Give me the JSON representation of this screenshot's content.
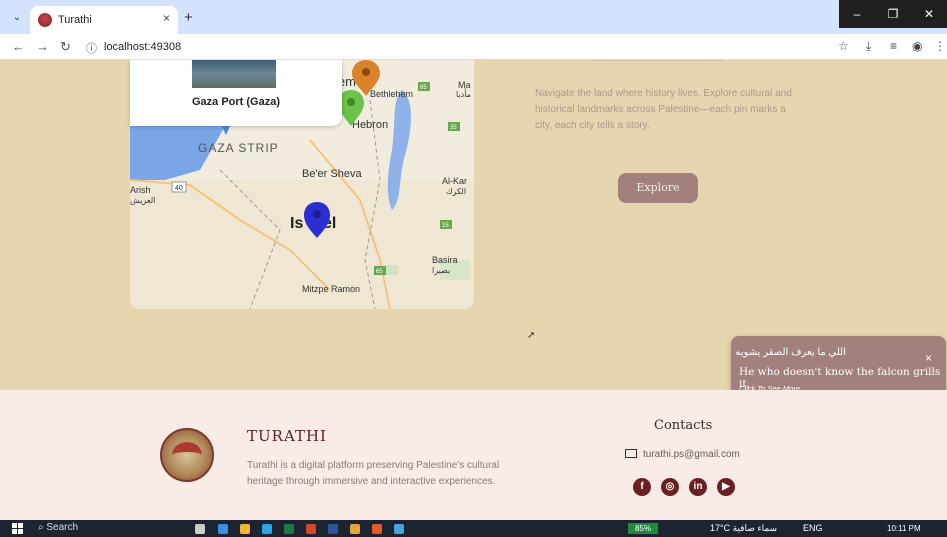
{
  "browser": {
    "tab_title": "Turathi",
    "tab_close": "×",
    "new_tab": "+",
    "url": "localhost:49308",
    "win_minimize": "–",
    "win_maximize": "❐",
    "win_close": "✕"
  },
  "map": {
    "popup_title": "Gaza Port (Gaza)",
    "labels": {
      "jerusalem_partial": "lem",
      "bethlehem": "Bethlehem",
      "hebron": "Hebron",
      "gaza_strip": "GAZA STRIP",
      "beer_sheva": "Be'er Sheva",
      "arish": "Arish",
      "arish_ar": "العريش",
      "road_40": "40",
      "israel_partial_left": "Is",
      "israel_partial_right": "el",
      "basira": "Basira",
      "basira_ar": "بصيرا",
      "mitzpe": "Mitzpe Ramon",
      "al_kark": "Al-Kar",
      "al_kark_ar": "الكرك",
      "ma": "Ma",
      "ma_ar": "مأدبا",
      "road_65_a": "65",
      "road_35": "35",
      "road_65_b": "65",
      "road_15": "15"
    },
    "marker_colors": {
      "orange": "#d9822b",
      "green": "#6cc24a",
      "blue": "#2a2fd1"
    }
  },
  "section": {
    "description": "Navigate the land where history lives. Explore cultural and historical landmarks across Palestine—each pin marks a city, each city tells a story.",
    "explore_label": "Explore"
  },
  "toast": {
    "arabic": "اللي ما يعرف الصقر يشويه",
    "english": "He who doesn't know the falcon grills it.",
    "more": "Click To See More",
    "close": "×"
  },
  "footer": {
    "brand": "TURATHI",
    "description": "Turathi is a digital platform preserving Palestine's cultural heritage through immersive and interactive experiences.",
    "contacts_title": "Contacts",
    "email": "turathi.ps@gmail.com",
    "social": [
      "f",
      "◎",
      "in",
      "▶"
    ]
  },
  "taskbar": {
    "search": "Search",
    "battery": "85%",
    "weather": "17°C  سماء صافية",
    "tray": "ENG",
    "clock": "10:11 PM"
  },
  "colors": {
    "page_bg": "#e6d6b0",
    "footer_bg": "#f9ece6",
    "accent": "#a2817c",
    "brand": "#5a1f22"
  }
}
